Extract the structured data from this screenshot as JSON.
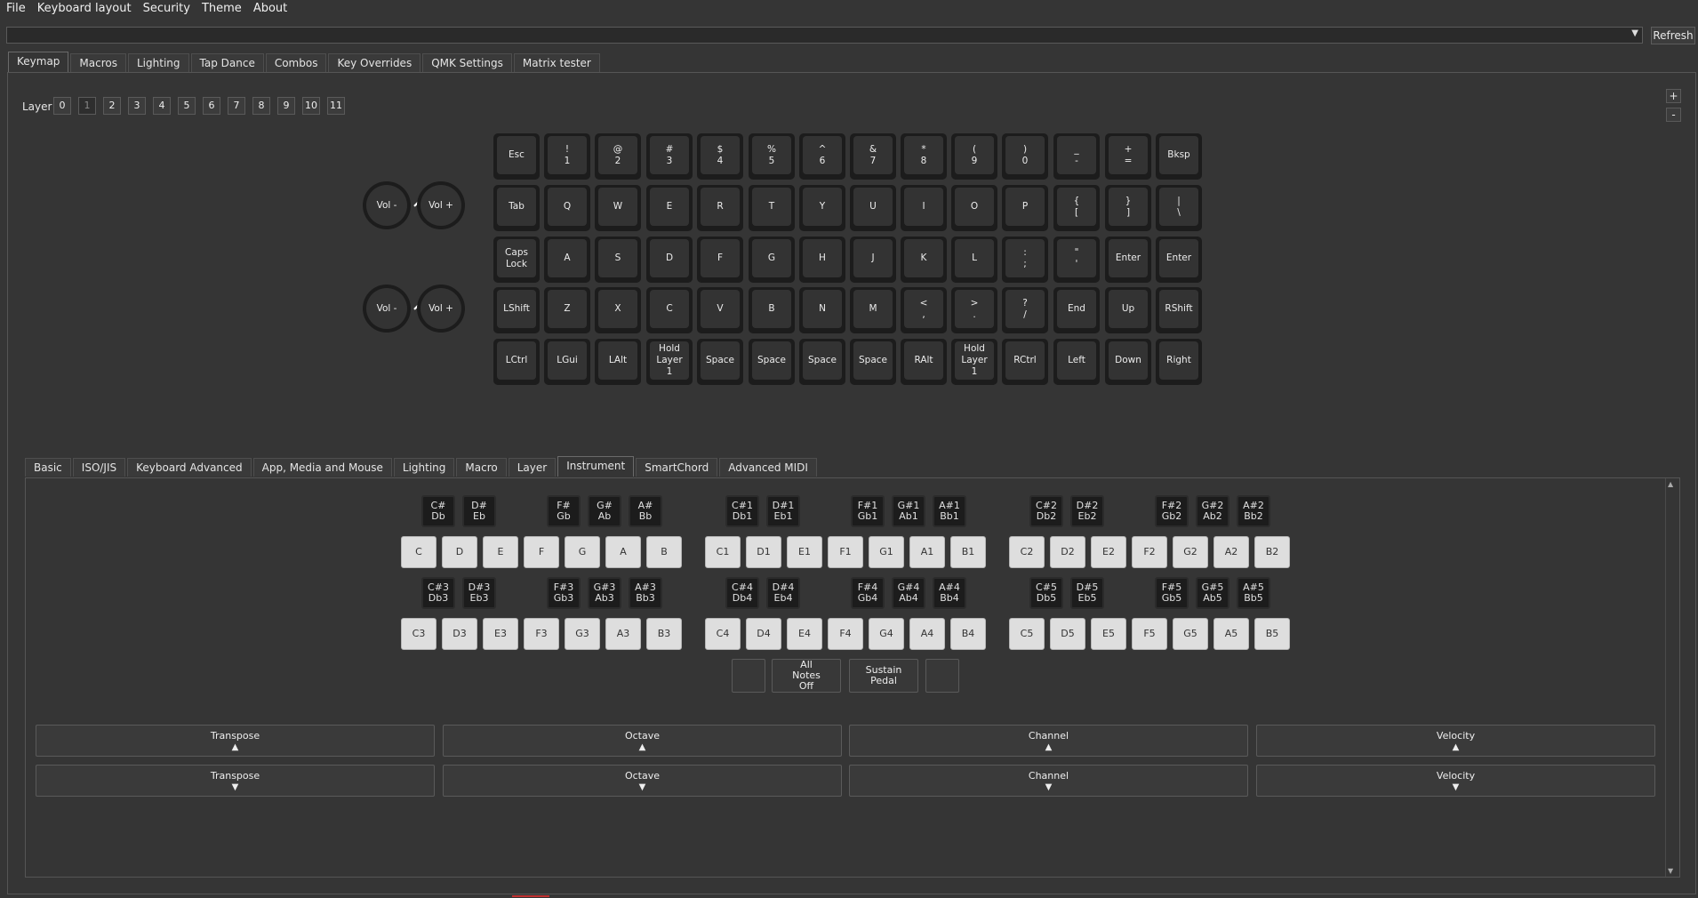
{
  "menubar": [
    "File",
    "Keyboard layout",
    "Security",
    "Theme",
    "About"
  ],
  "device": {
    "selected": "",
    "refresh_label": "Refresh"
  },
  "main_tabs": [
    {
      "label": "Keymap",
      "active": true
    },
    {
      "label": "Macros"
    },
    {
      "label": "Lighting"
    },
    {
      "label": "Tap Dance"
    },
    {
      "label": "Combos"
    },
    {
      "label": "Key Overrides"
    },
    {
      "label": "QMK Settings"
    },
    {
      "label": "Matrix tester"
    }
  ],
  "layer": {
    "label": "Layer",
    "buttons": [
      "0",
      "1",
      "2",
      "3",
      "4",
      "5",
      "6",
      "7",
      "8",
      "9",
      "10",
      "11"
    ],
    "active": "1"
  },
  "zoom": {
    "plus": "+",
    "minus": "-"
  },
  "encoders": [
    {
      "ccw_icon": "chevron-down-icon",
      "ccw": "Vol -",
      "cw_icon": "chevron-up-icon",
      "cw": "Vol +"
    },
    {
      "ccw_icon": "chevron-down-icon",
      "ccw": "Vol -",
      "cw_icon": "chevron-up-icon",
      "cw": "Vol +"
    }
  ],
  "keymap": [
    [
      "Esc",
      "!\n1",
      "@\n2",
      "#\n3",
      "$\n4",
      "%\n5",
      "^\n6",
      "&\n7",
      "*\n8",
      "(\n9",
      ")\n0",
      "_\n-",
      "+\n=",
      "Bksp"
    ],
    [
      "Tab",
      "Q",
      "W",
      "E",
      "R",
      "T",
      "Y",
      "U",
      "I",
      "O",
      "P",
      "{\n[",
      "}\n]",
      "|\n\\"
    ],
    [
      "Caps\nLock",
      "A",
      "S",
      "D",
      "F",
      "G",
      "H",
      "J",
      "K",
      "L",
      ":\n;",
      "\"\n'",
      "Enter",
      "Enter"
    ],
    [
      "LShift",
      "Z",
      "X",
      "C",
      "V",
      "B",
      "N",
      "M",
      "<\n,",
      ">\n.",
      "?\n/",
      "End",
      "Up",
      "RShift"
    ],
    [
      "LCtrl",
      "LGui",
      "LAlt",
      "Hold\nLayer\n1",
      "Space",
      "Space",
      "Space",
      "Space",
      "RAlt",
      "Hold\nLayer\n1",
      "RCtrl",
      "Left",
      "Down",
      "Right"
    ]
  ],
  "sub_tabs": [
    {
      "label": "Basic"
    },
    {
      "label": "ISO/JIS"
    },
    {
      "label": "Keyboard Advanced"
    },
    {
      "label": "App, Media and Mouse"
    },
    {
      "label": "Lighting"
    },
    {
      "label": "Macro"
    },
    {
      "label": "Layer"
    },
    {
      "label": "Instrument",
      "active": true
    },
    {
      "label": "SmartChord"
    },
    {
      "label": "Advanced MIDI"
    }
  ],
  "piano": {
    "octave_groups": [
      {
        "blacks": [
          "C#\nDb",
          "D#\nEb",
          "F#\nGb",
          "G#\nAb",
          "A#\nBb"
        ],
        "whites": [
          "C",
          "D",
          "E",
          "F",
          "G",
          "A",
          "B"
        ]
      },
      {
        "blacks": [
          "C#1\nDb1",
          "D#1\nEb1",
          "F#1\nGb1",
          "G#1\nAb1",
          "A#1\nBb1"
        ],
        "whites": [
          "C1",
          "D1",
          "E1",
          "F1",
          "G1",
          "A1",
          "B1"
        ]
      },
      {
        "blacks": [
          "C#2\nDb2",
          "D#2\nEb2",
          "F#2\nGb2",
          "G#2\nAb2",
          "A#2\nBb2"
        ],
        "whites": [
          "C2",
          "D2",
          "E2",
          "F2",
          "G2",
          "A2",
          "B2"
        ]
      },
      {
        "blacks": [
          "C#3\nDb3",
          "D#3\nEb3",
          "F#3\nGb3",
          "G#3\nAb3",
          "A#3\nBb3"
        ],
        "whites": [
          "C3",
          "D3",
          "E3",
          "F3",
          "G3",
          "A3",
          "B3"
        ]
      },
      {
        "blacks": [
          "C#4\nDb4",
          "D#4\nEb4",
          "F#4\nGb4",
          "G#4\nAb4",
          "A#4\nBb4"
        ],
        "whites": [
          "C4",
          "D4",
          "E4",
          "F4",
          "G4",
          "A4",
          "B4"
        ]
      },
      {
        "blacks": [
          "C#5\nDb5",
          "D#5\nEb5",
          "F#5\nGb5",
          "G#5\nAb5",
          "A#5\nBb5"
        ],
        "whites": [
          "C5",
          "D5",
          "E5",
          "F5",
          "G5",
          "A5",
          "B5"
        ]
      }
    ],
    "controls": [
      "",
      "All\nNotes\nOff",
      "Sustain\nPedal",
      ""
    ]
  },
  "adjust_up": [
    {
      "label": "Transpose",
      "arrow": "▲"
    },
    {
      "label": "Octave",
      "arrow": "▲"
    },
    {
      "label": "Channel",
      "arrow": "▲"
    },
    {
      "label": "Velocity",
      "arrow": "▲"
    }
  ],
  "adjust_down": [
    {
      "label": "Transpose",
      "arrow": "▼"
    },
    {
      "label": "Octave",
      "arrow": "▼"
    },
    {
      "label": "Channel",
      "arrow": "▼"
    },
    {
      "label": "Velocity",
      "arrow": "▼"
    }
  ]
}
